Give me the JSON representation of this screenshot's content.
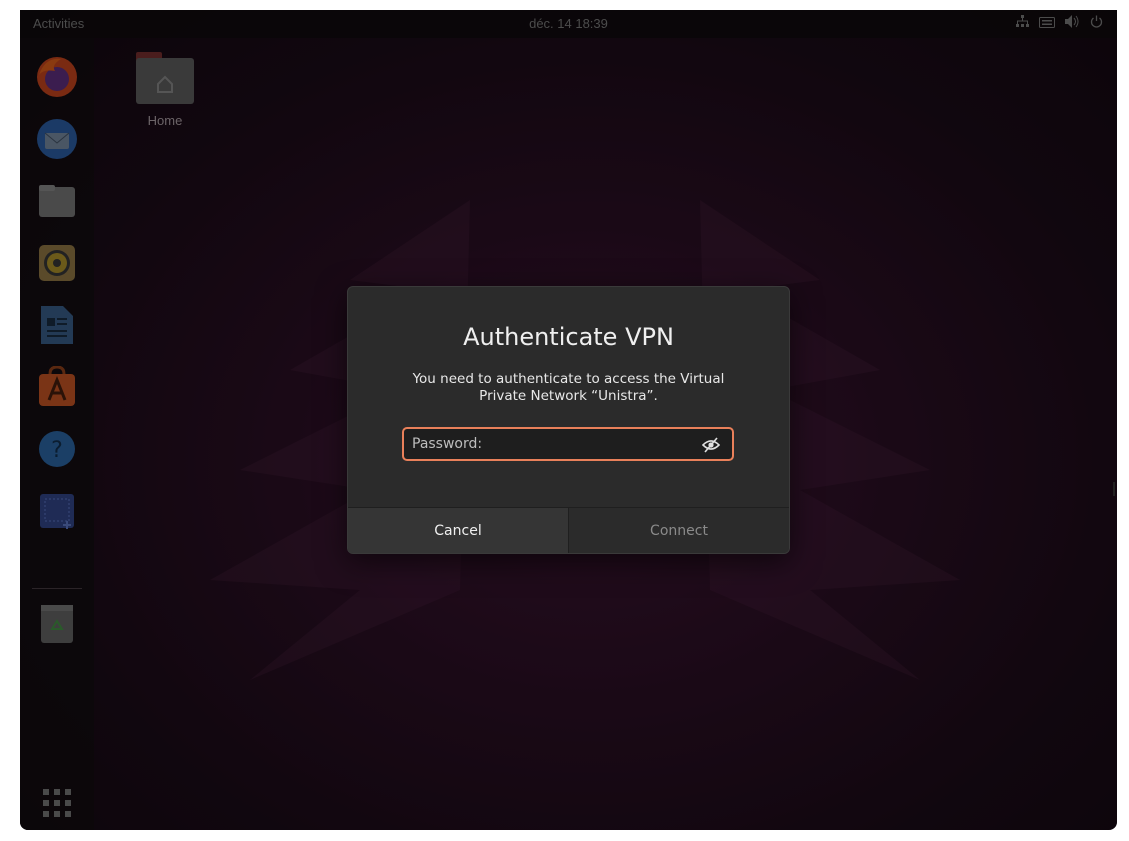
{
  "topbar": {
    "activities": "Activities",
    "clock": "déc. 14  18:39",
    "tray_icons": [
      "network-icon",
      "keyboard-icon",
      "volume-icon",
      "power-icon"
    ]
  },
  "dock": {
    "items": [
      "firefox-icon",
      "thunderbird-icon",
      "files-icon",
      "rhythmbox-icon",
      "writer-icon",
      "software-icon",
      "help-icon",
      "screenshot-icon",
      "trash-icon"
    ],
    "show_apps": "apps-grid-icon"
  },
  "desktop": {
    "home_label": "Home"
  },
  "dialog": {
    "title": "Authenticate VPN",
    "message": "You need to authenticate to access the Virtual Private Network “Unistra”.",
    "password_placeholder": "Password:",
    "password_value": "",
    "cancel_label": "Cancel",
    "connect_label": "Connect"
  },
  "colors": {
    "accent": "#e9805a",
    "dialog_bg": "#2b2b2b",
    "wallpaper": "#2a0f24"
  }
}
